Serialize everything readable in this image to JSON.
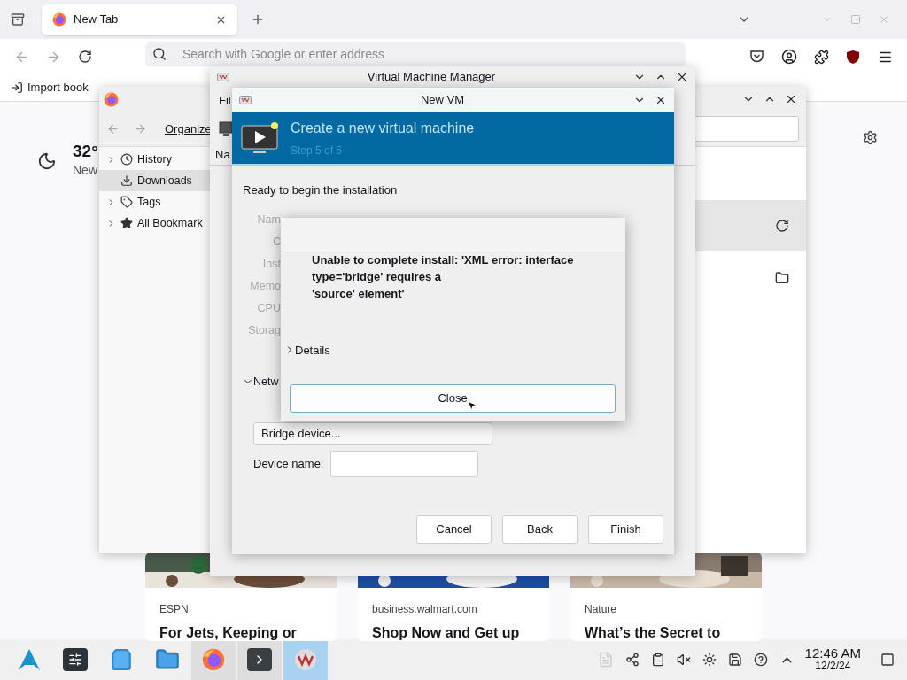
{
  "browser": {
    "tabs": [
      {
        "label": "New Tab",
        "selected": true
      }
    ],
    "address": {
      "placeholder": "Search with Google or enter address"
    },
    "bookmarks_bar": [
      "Import book"
    ],
    "weather": {
      "temperature": "32°",
      "location": "New"
    },
    "stories": [
      {
        "source": "ESPN",
        "headline": "For Jets, Keeping or"
      },
      {
        "source": "business.walmart.com",
        "headline": "Shop Now and Get up"
      },
      {
        "source": "Nature",
        "headline": "What’s the Secret to"
      }
    ]
  },
  "library": {
    "toolbar": [
      "Organize"
    ],
    "tree": [
      {
        "label": "History",
        "kind": "history",
        "expandable": true,
        "selected": false
      },
      {
        "label": "Downloads",
        "kind": "downloads",
        "expandable": false,
        "selected": true
      },
      {
        "label": "Tags",
        "kind": "tags",
        "expandable": true,
        "selected": false
      },
      {
        "label": "All Bookmark",
        "kind": "bookmarks",
        "expandable": true,
        "selected": false
      }
    ]
  },
  "vmm": {
    "title": "Virtual Machine Manager",
    "menu": [
      "Fil"
    ],
    "column": "Na"
  },
  "new_vm": {
    "title": "New VM",
    "heading": "Create a new virtual machine",
    "step": "Step 5 of 5",
    "intro": "Ready to begin the installation",
    "labels": [
      "Nam",
      "C",
      "Inst",
      "Memo",
      "CPU",
      "Storag"
    ],
    "network": {
      "label": "Netw",
      "expanded": true,
      "source": "Bridge device...",
      "device_label": "Device name:"
    },
    "buttons": [
      "Cancel",
      "Back",
      "Finish"
    ]
  },
  "error": {
    "message": "Unable to complete install: 'XML error: interface type='bridge' requires a\n'source' element'",
    "details": {
      "label": "Details",
      "expanded": false
    },
    "button": "Close"
  },
  "taskbar": {
    "apps": [
      {
        "kind": "launcher",
        "active": false
      },
      {
        "kind": "settings",
        "active": false
      },
      {
        "kind": "store",
        "active": false
      },
      {
        "kind": "files",
        "active": false
      },
      {
        "kind": "firefox",
        "active": false
      },
      {
        "kind": "terminal",
        "active": false
      },
      {
        "kind": "vmm",
        "active": true
      }
    ],
    "clock": {
      "time": "12:46 AM",
      "date": "12/2/24"
    }
  }
}
